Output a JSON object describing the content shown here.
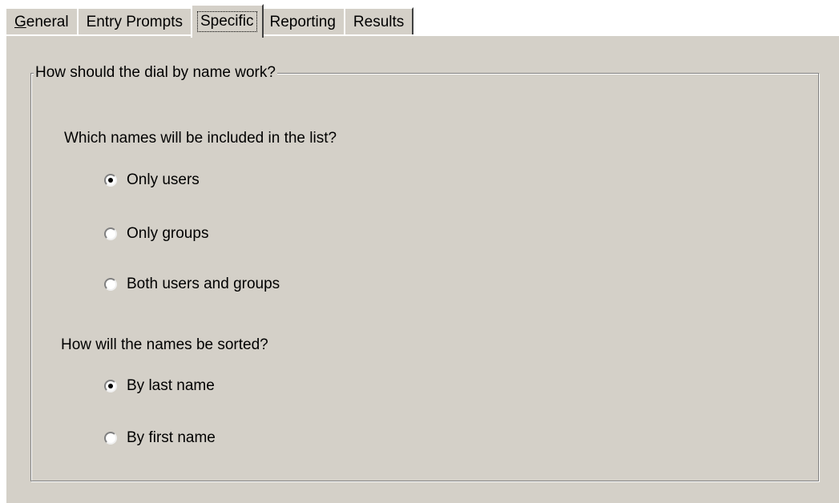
{
  "tabs": [
    {
      "accel": "G",
      "label": "eneral",
      "active": false
    },
    {
      "accel": "",
      "label": "Entry Prompts",
      "active": false
    },
    {
      "accel": "",
      "label": "Specific",
      "active": true
    },
    {
      "accel": "",
      "label": "Reporting",
      "active": false
    },
    {
      "accel": "",
      "label": "Results",
      "active": false
    }
  ],
  "group": {
    "title": "How should the dial by name work?"
  },
  "names_question": {
    "label": "Which names will be included in the list?",
    "options": [
      {
        "label": "Only users",
        "selected": true
      },
      {
        "label": "Only groups",
        "selected": false
      },
      {
        "label": "Both users and groups",
        "selected": false
      }
    ]
  },
  "sort_question": {
    "label": "How will the names be sorted?",
    "options": [
      {
        "label": "By last name",
        "selected": true
      },
      {
        "label": "By first name",
        "selected": false
      }
    ]
  }
}
